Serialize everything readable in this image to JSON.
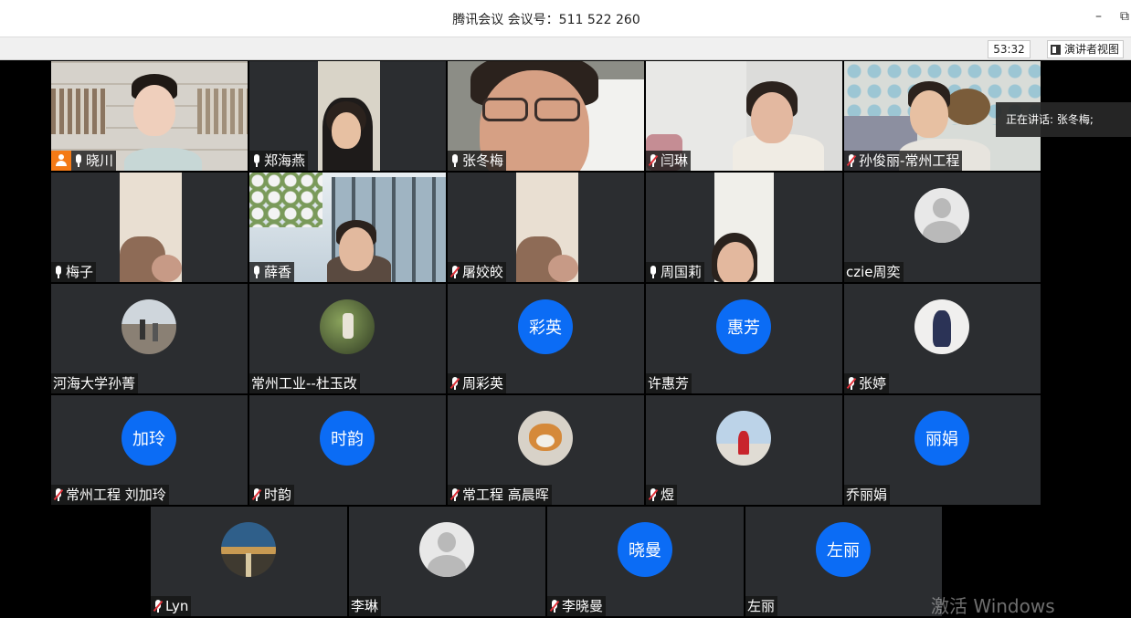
{
  "window": {
    "title": "腾讯会议 会议号：511 522 260",
    "minimize_glyph": "–",
    "restore_glyph": "⧉"
  },
  "toolbar": {
    "timer": "53:32",
    "speaker_view_label": "演讲者视图"
  },
  "speaking_banner": "正在讲话: 张冬梅;",
  "watermark": "激活 Windows",
  "rows": [
    [
      {
        "name": "晓川",
        "kind": "video",
        "scene": "bookshelf",
        "mic": "on",
        "host": true
      },
      {
        "name": "郑海燕",
        "kind": "video",
        "scene": "dark-room",
        "mic": "on"
      },
      {
        "name": "张冬梅",
        "kind": "video",
        "scene": "close-up",
        "mic": "on",
        "active": true
      },
      {
        "name": "闫琳",
        "kind": "video",
        "scene": "white-room",
        "mic": "muted"
      },
      {
        "name": "孙俊丽-常州工程",
        "kind": "video",
        "scene": "hex-wall",
        "mic": "muted"
      }
    ],
    [
      {
        "name": "梅子",
        "kind": "video",
        "scene": "door-frame",
        "mic": "on"
      },
      {
        "name": "薛香",
        "kind": "video",
        "scene": "outdoor-building",
        "mic": "on"
      },
      {
        "name": "屠姣皎",
        "kind": "video",
        "scene": "door-frame",
        "mic": "muted"
      },
      {
        "name": "周国莉",
        "kind": "video",
        "scene": "door-frame-2",
        "mic": "on"
      },
      {
        "name": "czie周奕",
        "kind": "avatar-grey",
        "mic": "none"
      }
    ],
    [
      {
        "name": "河海大学孙菁",
        "kind": "avatar-photo",
        "photo": "beach",
        "mic": "none"
      },
      {
        "name": "常州工业--杜玉改",
        "kind": "avatar-photo",
        "photo": "garden",
        "mic": "none"
      },
      {
        "name": "周彩英",
        "kind": "avatar-text",
        "avatar_text": "彩英",
        "mic": "muted"
      },
      {
        "name": "许惠芳",
        "kind": "avatar-text",
        "avatar_text": "惠芳",
        "mic": "none"
      },
      {
        "name": "张婷",
        "kind": "avatar-photo",
        "photo": "dress",
        "mic": "muted"
      }
    ],
    [
      {
        "name": "常州工程 刘加玲",
        "kind": "avatar-text",
        "avatar_text": "加玲",
        "mic": "muted"
      },
      {
        "name": "时韵",
        "kind": "avatar-text",
        "avatar_text": "时韵",
        "mic": "muted"
      },
      {
        "name": "常工程 高晨晖",
        "kind": "avatar-photo",
        "photo": "cat",
        "mic": "muted"
      },
      {
        "name": "煜",
        "kind": "avatar-photo",
        "photo": "red-dress",
        "mic": "muted"
      },
      {
        "name": "乔丽娟",
        "kind": "avatar-text",
        "avatar_text": "丽娟",
        "mic": "none"
      }
    ],
    [
      {
        "name": "Lyn",
        "kind": "avatar-photo",
        "photo": "road",
        "mic": "muted"
      },
      {
        "name": "李琳",
        "kind": "avatar-grey",
        "mic": "none"
      },
      {
        "name": "李晓曼",
        "kind": "avatar-text",
        "avatar_text": "晓曼",
        "mic": "muted"
      },
      {
        "name": "左丽",
        "kind": "avatar-text",
        "avatar_text": "左丽",
        "mic": "none"
      }
    ]
  ],
  "colors": {
    "accent_blue": "#0b6cf5",
    "active_border": "#3bb34a",
    "muted_red": "#e0323a",
    "host_orange": "#f47a16",
    "tile_bg": "#2b2d30"
  }
}
